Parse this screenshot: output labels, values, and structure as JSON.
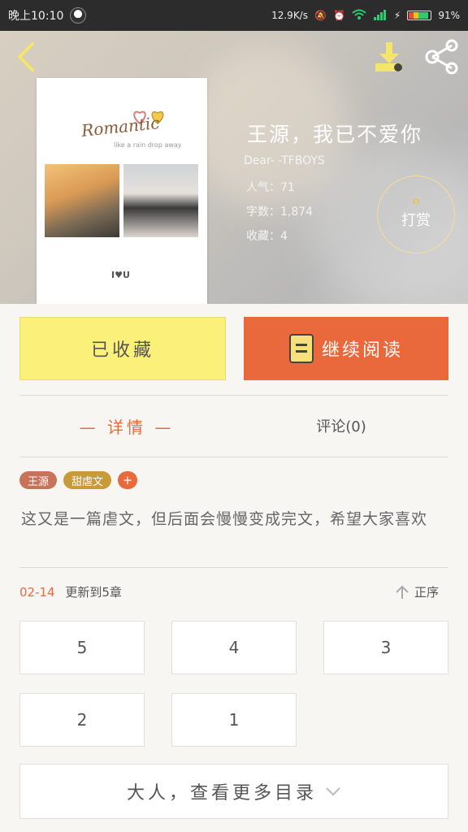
{
  "status_bar": {
    "time": "晚上10:10",
    "speed": "12.9K/s",
    "battery": "91%"
  },
  "book": {
    "title": "王源，我已不爱你",
    "author": "Dear- -TFBOYS",
    "popularity": "人气：71",
    "word_count": "字数：1,874",
    "collections": "收藏：4",
    "cover_text": "Romantic",
    "cover_sub": "like a rain drop away",
    "cover_iu": "I♥U"
  },
  "reward_label": "打赏",
  "buttons": {
    "collected": "已收藏",
    "continue_reading": "继续阅读"
  },
  "tabs": {
    "detail": "— 详情 —",
    "comments": "评论(0)"
  },
  "tags": [
    {
      "label": "王源",
      "color": "#c9725a"
    },
    {
      "label": "甜虐文",
      "color": "#c99a3a"
    }
  ],
  "tag_add": "+",
  "description": "这又是一篇虐文，但后面会慢慢变成完文，希望大家喜欢",
  "update": {
    "date": "02-14",
    "text": "更新到5章"
  },
  "sort_label": "正序",
  "chapters": [
    "5",
    "4",
    "3",
    "2",
    "1"
  ],
  "more_label": "大人，查看更多目录",
  "colors": {
    "accent": "#e9693c",
    "collected_bg": "#fbf07a"
  }
}
